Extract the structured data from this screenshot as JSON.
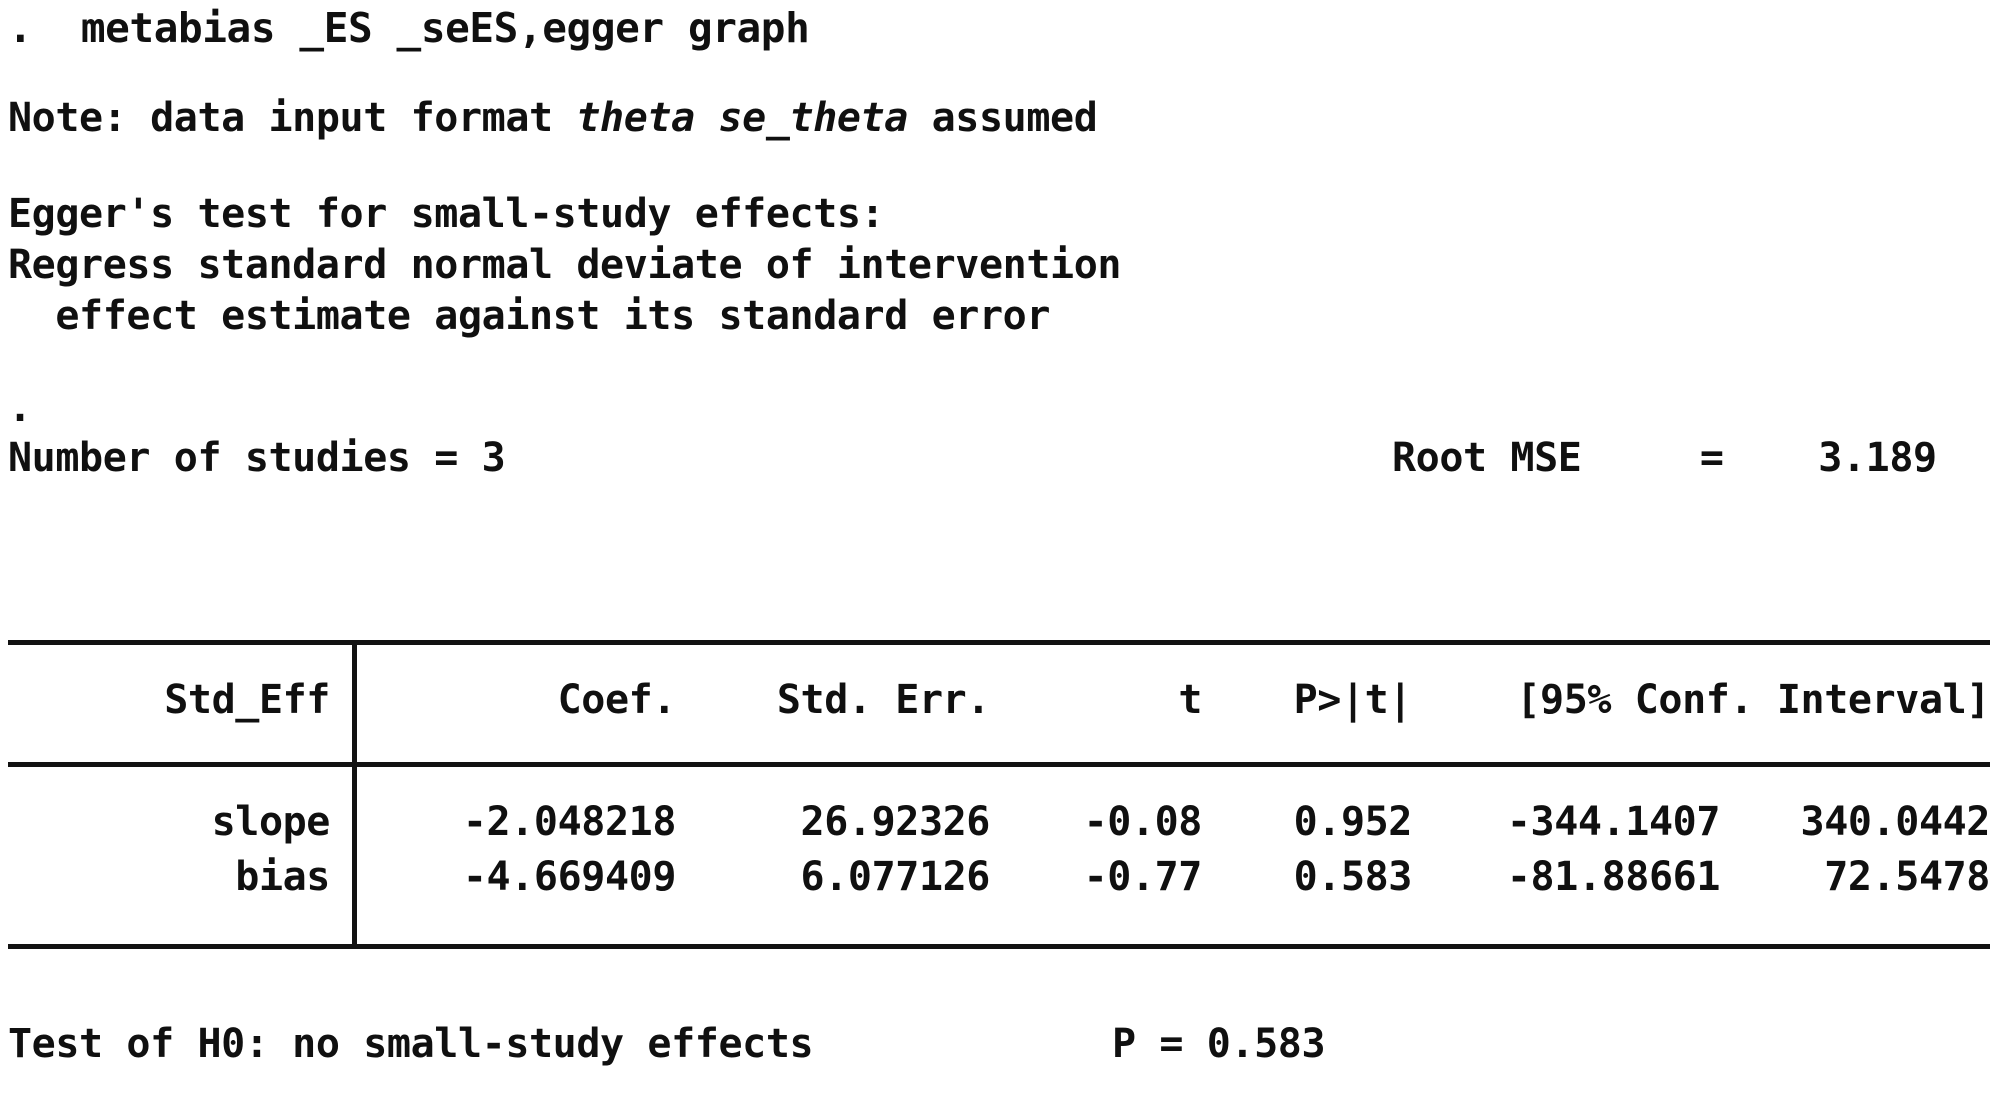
{
  "terminal": {
    "prompt_symbol": ".",
    "command": ".  metabias _ES _seES,egger graph",
    "note_prefix": "Note: data input format ",
    "note_emphasis": "theta se_theta",
    "note_suffix": " assumed",
    "egger_heading": "Egger's test for small-study effects:",
    "egger_desc_line1": "Regress standard normal deviate of intervention",
    "egger_desc_line2": "  effect estimate against its standard error",
    "second_prompt": ".",
    "summary": {
      "n_studies_label": "Number of studies = ",
      "n_studies_value": "3",
      "root_mse_label": "Root MSE",
      "root_mse_eq": "=",
      "root_mse_value": "3.189"
    },
    "table": {
      "headers": {
        "name": "Std_Eff",
        "coef": "Coef.",
        "std_err": "Std. Err.",
        "t": "t",
        "p": "P>|t|",
        "conf_interval": "[95% Conf. Interval]"
      },
      "rows": [
        {
          "name": "slope",
          "coef": "-2.048218",
          "std_err": "26.92326",
          "t": "-0.08",
          "p": "0.952",
          "ci_low": "-344.1407",
          "ci_high": "340.0442"
        },
        {
          "name": "bias",
          "coef": "-4.669409",
          "std_err": "6.077126",
          "t": "-0.77",
          "p": "0.583",
          "ci_low": "-81.88661",
          "ci_high": "72.5478"
        }
      ]
    },
    "test": {
      "label": "Test of H0: no small-study effects",
      "p_text": "P = 0.583"
    }
  },
  "colors": {
    "background": "#ffffff",
    "text": "#101010",
    "rule": "#121212"
  }
}
